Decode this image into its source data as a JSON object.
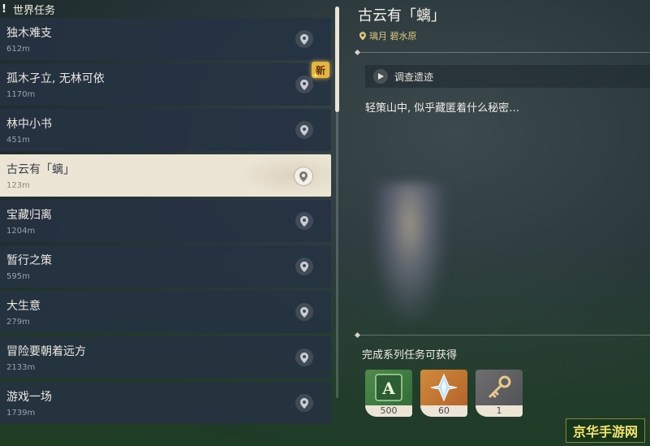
{
  "list_header": {
    "icon": "exclamation-icon",
    "title": "世界任务"
  },
  "quests": [
    {
      "title": "独木难支",
      "distance": "612m",
      "selected": false,
      "is_new": false
    },
    {
      "title": "孤木孑立, 无林可依",
      "distance": "1170m",
      "selected": false,
      "is_new": true,
      "new_label": "新"
    },
    {
      "title": "林中小书",
      "distance": "451m",
      "selected": false,
      "is_new": false
    },
    {
      "title": "古云有「螭」",
      "distance": "123m",
      "selected": true,
      "is_new": false
    },
    {
      "title": "宝藏归离",
      "distance": "1204m",
      "selected": false,
      "is_new": false
    },
    {
      "title": "暂行之策",
      "distance": "595m",
      "selected": false,
      "is_new": false
    },
    {
      "title": "大生意",
      "distance": "279m",
      "selected": false,
      "is_new": false
    },
    {
      "title": "冒险要朝着远方",
      "distance": "2133m",
      "selected": false,
      "is_new": false
    },
    {
      "title": "游戏一场",
      "distance": "1739m",
      "selected": false,
      "is_new": false
    }
  ],
  "detail": {
    "title": "古云有「螭」",
    "location": "璃月 碧水原",
    "investigate_label": "调查遗迹",
    "description": "轻策山中, 似乎藏匿着什么秘密…",
    "rewards_label": "完成系列任务可获得",
    "rewards": [
      {
        "icon": "adventure-exp-icon",
        "count": "500"
      },
      {
        "icon": "primogem-icon",
        "count": "60"
      },
      {
        "icon": "key-icon",
        "count": "1"
      }
    ]
  },
  "watermark": "京华手游网",
  "colors": {
    "new_badge": "#e7b440",
    "location": "#e0c77a",
    "selected_row": "#ece5d6"
  }
}
